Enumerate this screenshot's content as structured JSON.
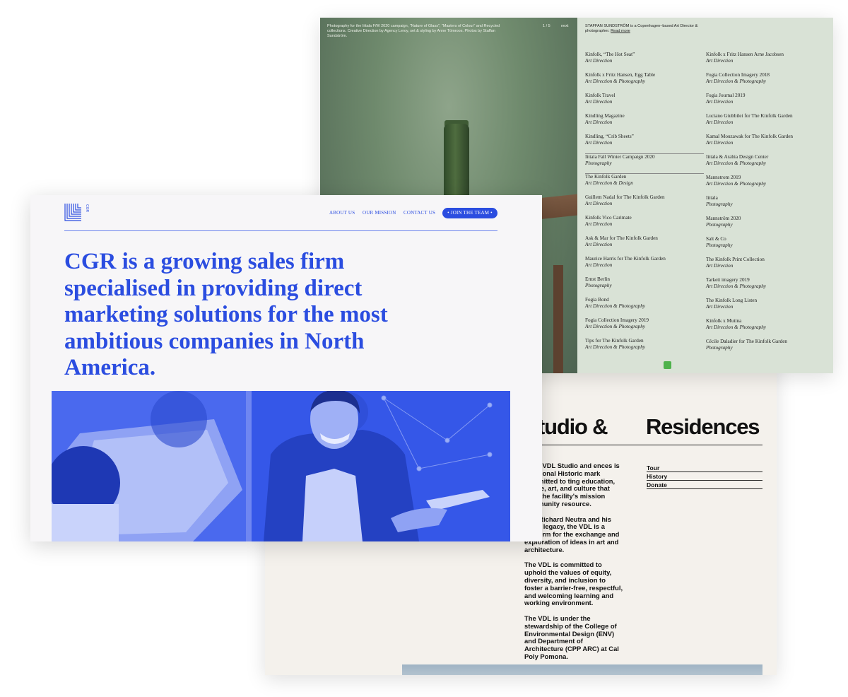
{
  "vdl": {
    "title_part1": "tudio &",
    "title_part2": "Residences",
    "paragraphs": [
      "eutra VDL Studio and ences is a National Historic mark committed to ting education, ecture, art, and culture that then the facility's mission community resource.",
      "ring Richard Neutra and his one's legacy, the VDL is a platform for the exchange and exploration of ideas in art and architecture.",
      "The VDL is committed to uphold the values of equity, diversity, and inclusion to foster a barrier-free, respectful, and welcoming learning and working environment.",
      "The VDL is under the stewardship of the College of Environmental Design (ENV) and Department of Architecture (CPP ARC) at Cal Poly Pomona."
    ],
    "links": [
      "Tour",
      "History",
      "Donate"
    ]
  },
  "staffan": {
    "caption": "Photography for the Iittala F/W 2020 campaign, \"Nature of Glass\", \"Masters of Colour\" and Recycled collections. Creative Direction by Agency Leroy, set & styling by Anne Tömroos. Photos by Staffan Sundström.",
    "counter": "1 / 5",
    "next": "next",
    "intro": "STAFFAN SUNDSTRÖM is a Copenhagen–based Art Director & photographer.",
    "read_more": "Read more",
    "projects_col1": [
      {
        "title": "Kinfolk, “The Hot Seat”",
        "role": "Art Direction"
      },
      {
        "title": "Kinfolk x Fritz Hansen, Egg Table",
        "role": "Art Direction & Photography"
      },
      {
        "title": "Kinfolk Travel",
        "role": "Art Direction"
      },
      {
        "title": "Kindling Magazine",
        "role": "Art Direction"
      },
      {
        "title": "Kindling, “Crib Sheets”",
        "role": "Art Direction"
      },
      {
        "title": "Iittala Fall Winter Campaign 2020",
        "role": "Photography"
      },
      {
        "title": "The Kinfolk Garden",
        "role": "Art Direction & Design"
      },
      {
        "title": "Guillem Nadal for The Kinfolk Garden",
        "role": "Art Direction"
      },
      {
        "title": "Kinfolk Vico Carimate",
        "role": "Art Direction"
      },
      {
        "title": "Ask & Mar for The Kinfolk Garden",
        "role": "Art Direction"
      },
      {
        "title": "Maurice Harris for The Kinfolk Garden",
        "role": "Art Direction"
      },
      {
        "title": "Ernst Berlin",
        "role": "Photography"
      },
      {
        "title": "Fogia Bond",
        "role": "Art Direction & Photography"
      },
      {
        "title": "Fogia Collection Imagery 2019",
        "role": "Art Direction & Photography"
      },
      {
        "title": "Tips for The Kinfolk Garden",
        "role": "Art Direction & Photography"
      }
    ],
    "projects_col2": [
      {
        "title": "Kinfolk x Fritz Hansen Arne Jacobsen",
        "role": "Art Direction"
      },
      {
        "title": "Fogia Collection Imagery 2018",
        "role": "Art Direction & Photography"
      },
      {
        "title": "Fogia Journal 2019",
        "role": "Art Direction"
      },
      {
        "title": "Luciano Giubbilei for The Kinfolk Garden",
        "role": "Art Direction"
      },
      {
        "title": "Kamal Mouzawak for The Kinfolk Garden",
        "role": "Art Direction"
      },
      {
        "title": "Iittala & Arabia Design Center",
        "role": "Art Direction & Photography"
      },
      {
        "title": "Mannstrom 2019",
        "role": "Art Direction & Photography"
      },
      {
        "title": "Iittala",
        "role": "Photography"
      },
      {
        "title": "Mannström 2020",
        "role": "Photography"
      },
      {
        "title": "Salt & Co",
        "role": "Photography"
      },
      {
        "title": "The Kinfolk Print Collection",
        "role": "Art Direction"
      },
      {
        "title": "Tarkett imagery 2019",
        "role": "Art Direction & Photography"
      },
      {
        "title": "The Kinfolk Long Listen",
        "role": "Art Direction"
      },
      {
        "title": "Kinfolk x Mutina",
        "role": "Art Direction & Photography"
      },
      {
        "title": "Cécile Daladier for The Kinfolk Garden",
        "role": "Photography"
      }
    ]
  },
  "cgr": {
    "logo_text": "CGR",
    "nav": {
      "about": "ABOUT US",
      "mission": "OUR MISSION",
      "contact": "CONTACT US",
      "cta": "• JOIN THE TEAM •"
    },
    "headline": "CGR is a growing sales firm specialised in providing direct marketing solutions for the most ambitious companies in North America."
  },
  "colors": {
    "cgr_blue": "#2b4de0",
    "ss_panel": "#d9e2d6",
    "vdl_bg": "#f4f1ec",
    "ss_dot": "#4fb24c"
  }
}
